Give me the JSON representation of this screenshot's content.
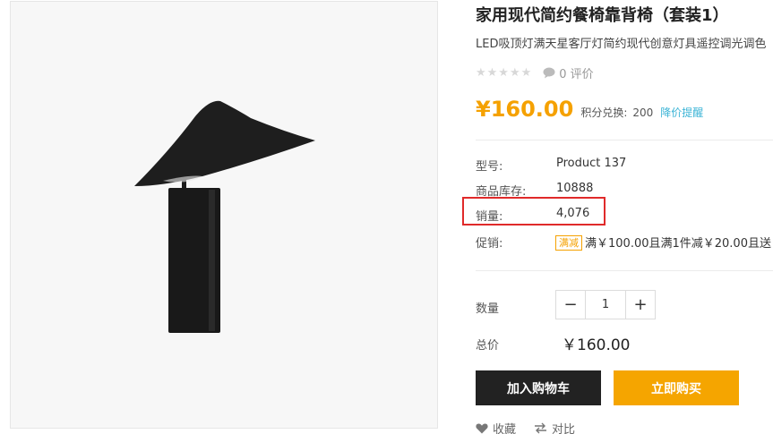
{
  "product": {
    "title": "家用现代简约餐椅靠背椅（套装1）",
    "subtitle": "LED吸顶灯满天星客厅灯简约现代创意灯具遥控调光调色",
    "rating": {
      "stars": "★★★★★",
      "count_text": "0 评价"
    },
    "price": "¥160.00",
    "points_label": "积分兑换:",
    "points_value": "200",
    "price_alert": "降价提醒"
  },
  "specs": {
    "model_label": "型号:",
    "model_value": "Product 137",
    "stock_label": "商品库存:",
    "stock_value": "10888",
    "sales_label": "销量:",
    "sales_value": "4,076",
    "promo_label": "促销:",
    "promo_badge": "满减",
    "promo_text": "满￥100.00且满1件减￥20.00且送"
  },
  "purchase": {
    "qty_label": "数量",
    "qty_value": "1",
    "minus": "−",
    "plus": "+",
    "total_label": "总价",
    "total_value": "￥160.00",
    "add_to_cart": "加入购物车",
    "buy_now": "立即购买"
  },
  "actions": {
    "favorite": "收藏",
    "compare": "对比"
  },
  "colors": {
    "accent": "#f5a100",
    "link": "#3bb4d6",
    "highlight": "#e02a2a",
    "dark": "#222222"
  },
  "icons": [
    "star-icon",
    "comment-icon",
    "heart-icon",
    "compare-icon"
  ]
}
